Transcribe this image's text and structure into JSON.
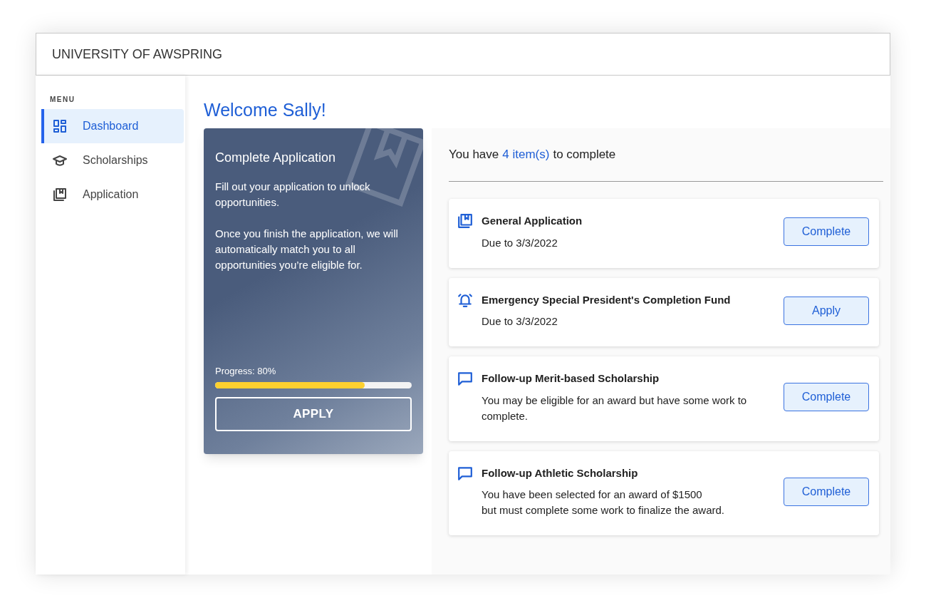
{
  "header": {
    "title": "UNIVERSITY OF AWSPRING"
  },
  "sidebar": {
    "heading": "MENU",
    "items": [
      {
        "label": "Dashboard",
        "kind": "dashboard",
        "selected": true
      },
      {
        "label": "Scholarships",
        "kind": "cap",
        "selected": false
      },
      {
        "label": "Application",
        "kind": "application",
        "selected": false
      }
    ]
  },
  "welcome": "Welcome Sally!",
  "promo_card": {
    "title": "Complete Application",
    "paragraphs": [
      "Fill out your application to unlock opportunities.",
      "Once you finish the application, we will automatically match you to all opportunities you’re eligible for."
    ],
    "progress_label": "Progress: 80%",
    "level": 0.76,
    "button": "APPLY"
  },
  "todo": {
    "prefix": "You have",
    "count": "4 item(s)",
    "suffix": "to complete",
    "items": [
      {
        "kind": "application",
        "title": "General Application",
        "lines": [
          "Due to 3/3/2022"
        ],
        "button": "Complete"
      },
      {
        "kind": "alarm",
        "title": "Emergency Special President's Completion Fund",
        "lines": [
          "Due to 3/3/2022"
        ],
        "button": "Apply"
      },
      {
        "kind": "message",
        "title": "Follow-up Merit-based Scholarship",
        "lines": [
          "You may be eligible for an award but have some work to complete."
        ],
        "button": "Complete"
      },
      {
        "kind": "message",
        "title": "Follow-up Athletic Scholarship",
        "lines": [
          "You have been selected for an award of $1500",
          "but must complete some work to finalize the award."
        ],
        "button": "Complete"
      }
    ]
  }
}
